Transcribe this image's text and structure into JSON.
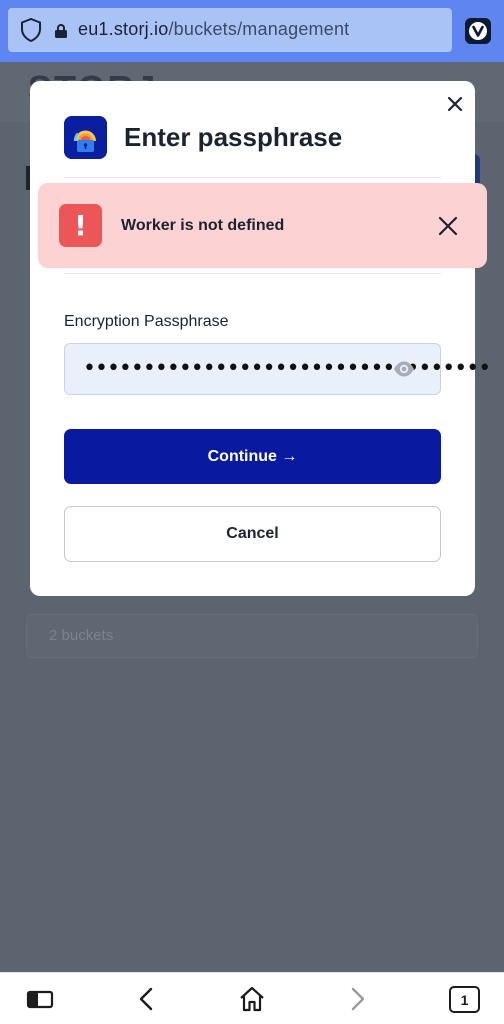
{
  "browser": {
    "url_domain": "eu1.storj.io",
    "url_path": "/buckets/management",
    "tab_count": "1"
  },
  "app": {
    "logo_text": "STORJ",
    "bucket_count": "2 buckets"
  },
  "modal": {
    "title": "Enter passphrase",
    "field_label": "Encryption Passphrase",
    "passphrase_masked": "••••••••••••••••••••••••••••••••••",
    "continue_label": "Continue →",
    "cancel_label": "Cancel"
  },
  "toast": {
    "message": "Worker is not defined"
  },
  "colors": {
    "primary": "#0a1aa0",
    "error_bg": "#fdd2d2",
    "error_icon": "#eb5757",
    "browser_bar": "#5f86f0"
  }
}
